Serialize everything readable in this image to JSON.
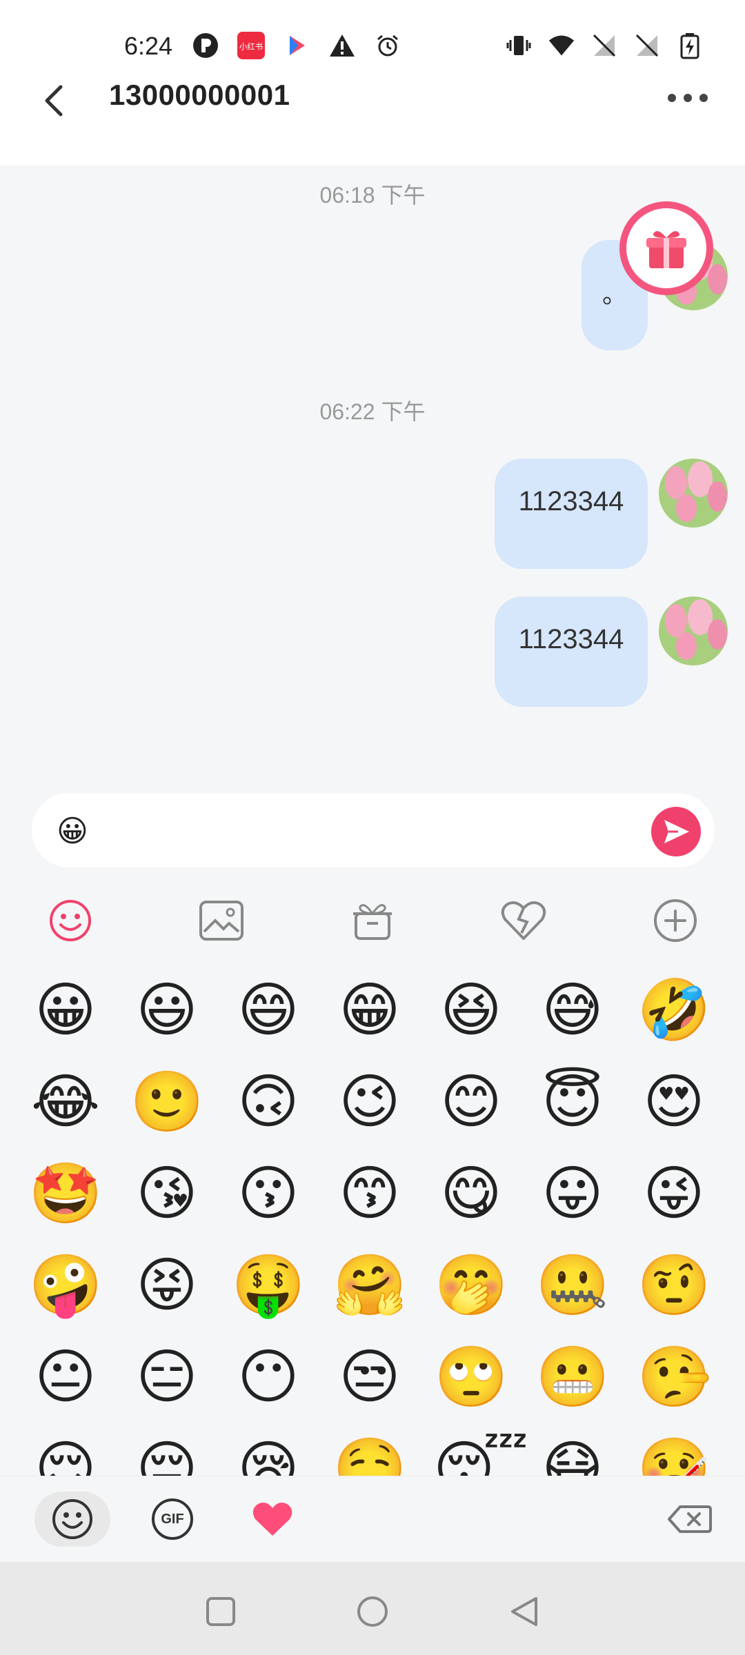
{
  "status": {
    "time": "6:24",
    "app_badge": "小红书"
  },
  "header": {
    "title": "13000000001"
  },
  "messages": [
    {
      "timestamp": "06:18 下午",
      "text": "。"
    },
    {
      "timestamp": "06:22 下午",
      "text": "1123344"
    },
    {
      "timestamp": "",
      "text": "1123344"
    }
  ],
  "input": {
    "value": "😀"
  },
  "emojis": [
    "😀",
    "😃",
    "😄",
    "😁",
    "😆",
    "😅",
    "🤣",
    "😂",
    "🙂",
    "🙃",
    "😉",
    "😊",
    "😇",
    "😍",
    "🤩",
    "😘",
    "😗",
    "😙",
    "😋",
    "😛",
    "😜",
    "🤪",
    "😝",
    "🤑",
    "🤗",
    "🤭",
    "🤐",
    "🤨",
    "😐",
    "😑",
    "😶",
    "😒",
    "🙄",
    "😬",
    "🤥",
    "😌",
    "😔",
    "😪",
    "🤤",
    "😴",
    "😷",
    "🤒"
  ],
  "panel": {
    "gif_label": "GIF"
  },
  "colors": {
    "accent": "#f0416c",
    "bubble": "#d6e6fb"
  }
}
